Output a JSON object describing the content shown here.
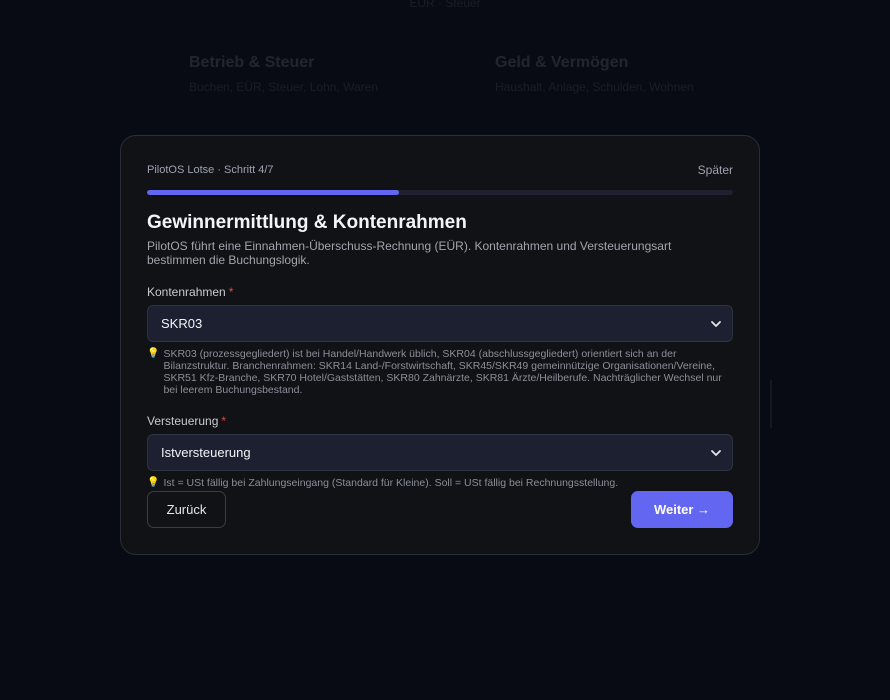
{
  "background": {
    "top_caption": "EÜR · Steuer",
    "cards": [
      {
        "title": "Betrieb & Steuer",
        "subtitle": "Buchen, EÜR, Steuer, Lohn, Waren"
      },
      {
        "title": "Geld & Vermögen",
        "subtitle": "Haushalt, Anlage, Schulden, Wohnen"
      }
    ]
  },
  "modal": {
    "step_label": "PilotOS Lotse · Schritt 4/7",
    "later_label": "Später",
    "progress": 0.43,
    "title": "Gewinnermittlung & Kontenrahmen",
    "description": "PilotOS führt eine Einnahmen-Überschuss-Rechnung (EÜR). Kontenrahmen und Versteuerungsart bestimmen die Buchungslogik.",
    "fields": [
      {
        "label": "Kontenrahmen",
        "required_mark": "*",
        "value": "SKR03",
        "hint": "SKR03 (prozessgegliedert) ist bei Handel/Handwerk üblich, SKR04 (abschlussgegliedert) orientiert sich an der Bilanzstruktur. Branchenrahmen: SKR14 Land-/Forstwirtschaft, SKR45/SKR49 gemeinnützige Organisationen/Vereine, SKR51 Kfz-Branche, SKR70 Hotel/Gaststätten, SKR80 Zahnärzte, SKR81 Ärzte/Heilberufe. Nachträglicher Wechsel nur bei leerem Buchungsbestand."
      },
      {
        "label": "Versteuerung",
        "required_mark": "*",
        "value": "Istversteuerung",
        "hint": "Ist = USt fällig bei Zahlungseingang (Standard für Kleine). Soll = USt fällig bei Rechnungsstellung."
      }
    ],
    "back_label": "Zurück",
    "next_label": "Weiter →"
  },
  "colors": {
    "accent": "#6366f1",
    "required": "#ef4444",
    "background": "#0b0f1a",
    "modal_bg": "#111216"
  },
  "icons": [
    "chevron-down-icon",
    "lightbulb-icon"
  ]
}
